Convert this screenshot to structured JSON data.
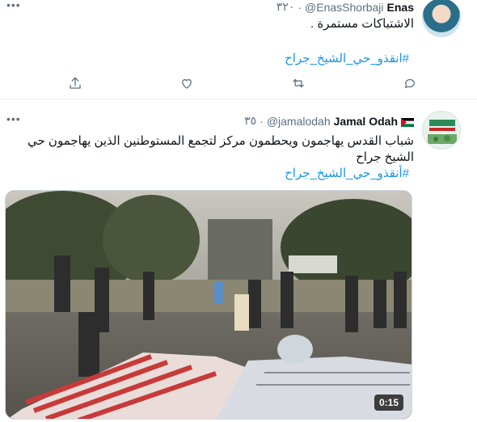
{
  "tweets": [
    {
      "name": "Enas",
      "handle": "@EnasShorbaji",
      "time": "٣٢٠",
      "text": "الاشتباكات مستمرة .",
      "hashtag": "#انقذو_حي_الشيخ_جراح",
      "avatar_icon": "profile-photo-woman",
      "actions": [
        "reply-icon",
        "retweet-icon",
        "like-icon",
        "share-icon"
      ]
    },
    {
      "name": "Jamal Odah",
      "name_flag": "palestine-flag-icon",
      "handle": "@jamalodah",
      "time": "٣٥",
      "text": "شباب القدس يهاجمون ويحطمون مركز لتجمع المستوطنين الذين يهاجمون حي الشيخ جراح",
      "hashtag": "#أنقذو_حي_الشيخ_جراح",
      "avatar_icon": "profile-photo-logo",
      "video": {
        "duration": "0:15"
      }
    }
  ],
  "ui": {
    "more_label": "•••",
    "dot": "·"
  },
  "colors": {
    "link": "#1b95e0",
    "secondary": "#5b7083",
    "divider": "#e6ecf0"
  }
}
